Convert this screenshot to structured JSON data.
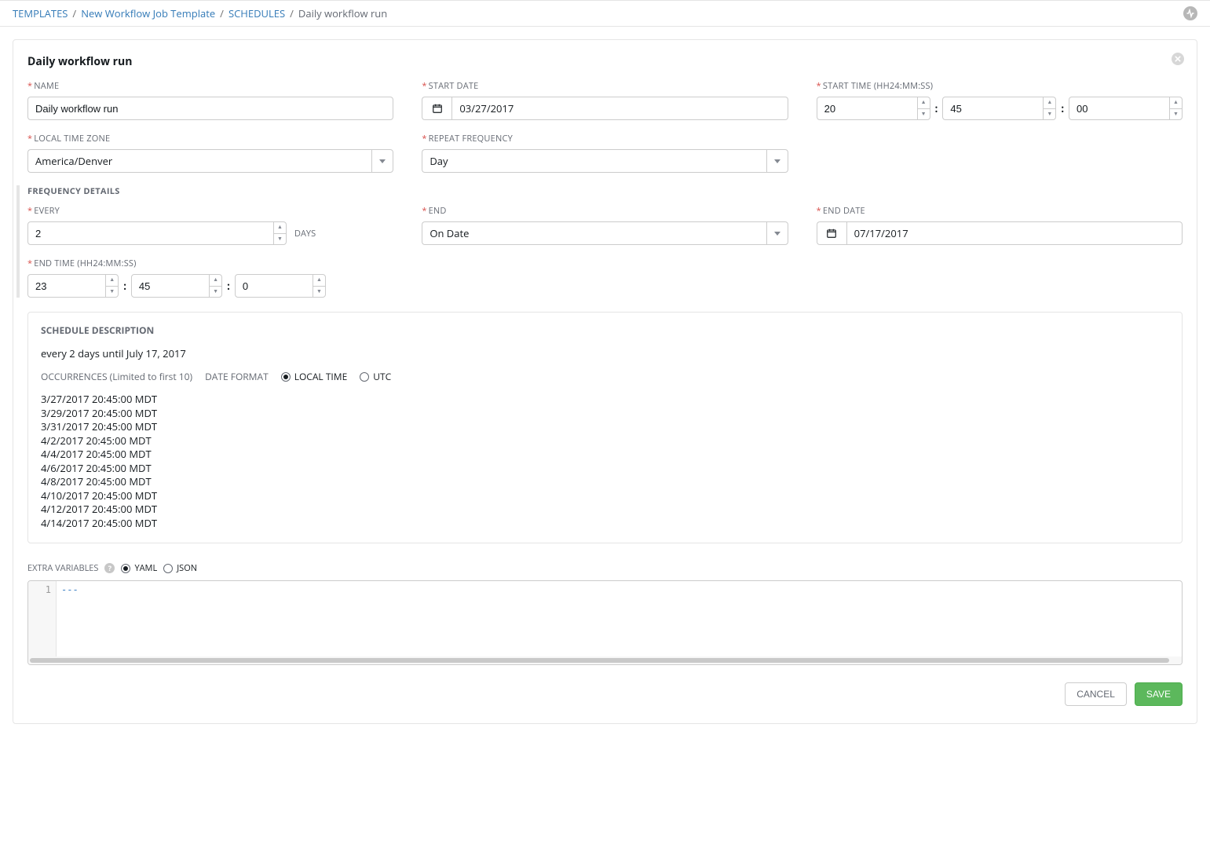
{
  "breadcrumb": {
    "templates": "TEMPLATES",
    "template_name": "New Workflow Job Template",
    "schedules": "SCHEDULES",
    "current": "Daily workflow run"
  },
  "panel": {
    "title": "Daily workflow run"
  },
  "labels": {
    "name": "NAME",
    "start_date": "START DATE",
    "start_time": "START TIME (HH24:MM:SS)",
    "local_tz": "LOCAL TIME ZONE",
    "repeat_freq": "REPEAT FREQUENCY",
    "freq_details": "FREQUENCY DETAILS",
    "every": "EVERY",
    "end": "END",
    "end_date": "END DATE",
    "end_time": "END TIME (HH24:MM:SS)",
    "days_unit": "DAYS",
    "schedule_desc": "SCHEDULE DESCRIPTION",
    "occurrences": "OCCURRENCES",
    "occurrences_hint": "(Limited to first 10)",
    "date_format": "DATE FORMAT",
    "local_time_opt": "LOCAL TIME",
    "utc_opt": "UTC",
    "extra_vars": "EXTRA VARIABLES",
    "yaml": "YAML",
    "json": "JSON",
    "cancel": "CANCEL",
    "save": "SAVE"
  },
  "form": {
    "name": "Daily workflow run",
    "start_date": "03/27/2017",
    "start_time": {
      "hh": "20",
      "mm": "45",
      "ss": "00"
    },
    "timezone": "America/Denver",
    "repeat": "Day",
    "every": "2",
    "end_mode": "On Date",
    "end_date": "07/17/2017",
    "end_time": {
      "hh": "23",
      "mm": "45",
      "ss": "0"
    }
  },
  "schedule": {
    "description": "every 2 days until July 17, 2017",
    "occurrences": [
      "3/27/2017 20:45:00 MDT",
      "3/29/2017 20:45:00 MDT",
      "3/31/2017 20:45:00 MDT",
      "4/2/2017 20:45:00 MDT",
      "4/4/2017 20:45:00 MDT",
      "4/6/2017 20:45:00 MDT",
      "4/8/2017 20:45:00 MDT",
      "4/10/2017 20:45:00 MDT",
      "4/12/2017 20:45:00 MDT",
      "4/14/2017 20:45:00 MDT"
    ]
  },
  "editor": {
    "line_number": "1",
    "content": "---"
  }
}
